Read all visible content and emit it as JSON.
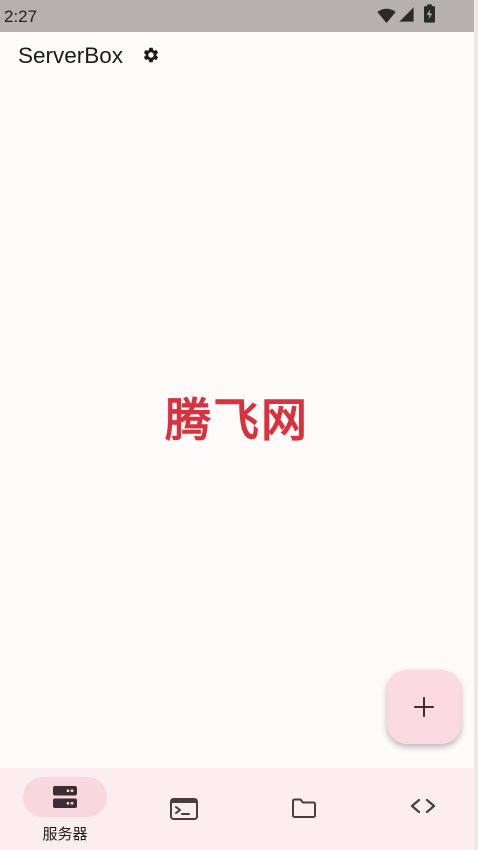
{
  "status_bar": {
    "time": "2:27",
    "icons": [
      "wifi-icon",
      "signal-icon",
      "battery-icon"
    ]
  },
  "app_bar": {
    "title": "ServerBox",
    "settings_icon": "gear-icon"
  },
  "watermark": {
    "text": "腾飞网"
  },
  "fab": {
    "icon": "plus-icon"
  },
  "bottom_nav": {
    "items": [
      {
        "icon": "server-icon",
        "label": "服务器",
        "selected": true
      },
      {
        "icon": "terminal-icon",
        "selected": false
      },
      {
        "icon": "folder-icon",
        "selected": false
      },
      {
        "icon": "code-icon",
        "selected": false
      }
    ]
  },
  "colors": {
    "bg": "#fffbfa",
    "text": "#1d1b1c",
    "icon": "#4b3c40",
    "status-bg": "#b5b1b1",
    "nav-bg": "#fcedf0",
    "indicator": "#f9d7df",
    "fab-bg": "#fcdae2",
    "watermark": "#d8323f"
  }
}
